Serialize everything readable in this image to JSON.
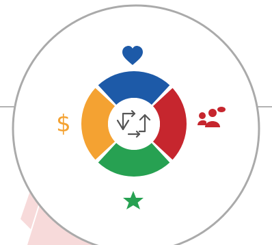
{
  "colors": {
    "top": "#1d5aa8",
    "right": "#c6262e",
    "bottom": "#27a152",
    "left": "#f4a232",
    "outer_ring": "#aaaaaa",
    "center_icon": "#555555",
    "background_stripe": "#f6d6d6"
  },
  "items": [
    {
      "position": "top",
      "icon": "heart-icon"
    },
    {
      "position": "right",
      "icon": "users-group-icon"
    },
    {
      "position": "bottom",
      "icon": "star-icon"
    },
    {
      "position": "left",
      "icon": "dollar-icon",
      "label": "$"
    }
  ],
  "center": {
    "icon": "exchange-arrows-icon"
  }
}
